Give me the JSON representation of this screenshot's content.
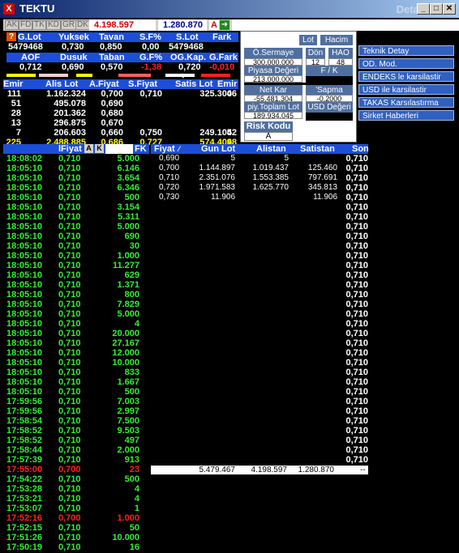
{
  "window": {
    "title": "TEKTU",
    "subtitle": "Detay",
    "icon": "X"
  },
  "toolbar": {
    "tabs": [
      "AK",
      "FD",
      "TK",
      "KD",
      "GR",
      "DK"
    ],
    "value1": "4.198.597",
    "value2": "1.280.870",
    "a_label": "A"
  },
  "summary1": {
    "headers": [
      "G.Lot",
      "Yuksek",
      "Tavan",
      "S.F%",
      "S.Lot",
      "Fark"
    ],
    "values": [
      "5479468",
      "0,730",
      "0,850",
      "0,00",
      "5479468",
      ""
    ]
  },
  "summary2": {
    "headers": [
      "AOF",
      "Dusuk",
      "Taban",
      "G.F%",
      "OG.Kap.",
      "G.Fark"
    ],
    "values": [
      "0,712",
      "0,690",
      "0,570",
      "-1,38",
      "0,720",
      "-0,010"
    ]
  },
  "panel": {
    "lot_btn": "Lot",
    "hacim_btn": "Hacim",
    "sermaye_label": "Ö.Sermaye",
    "sermaye": "300.000.000",
    "don_label": "Dön",
    "don": "12",
    "hao_label": "HAO",
    "hao": "48",
    "piyasa_label": "Piyasa Değeri",
    "piyasa": "213.000.000",
    "fk_label": "F / K",
    "netkar_label": "Net Kar",
    "netkar": "-55.481.304",
    "sapma_label": "'Sapma",
    "sapma": "-0,2000",
    "toplam_label": "piy.Toplam Lot",
    "toplam": "189.934.045",
    "usd_label": "USD Değeri",
    "risk_label": "Risk Kodu",
    "risk": "A"
  },
  "side_buttons": [
    "Teknik Detay",
    "OD. Mod.",
    "ENDEKS le karsilastir",
    "USD ile karsilastir",
    "TAKAS Karsılastırma",
    "Sirket Haberleri"
  ],
  "depth": {
    "headers": [
      "Emir",
      "Alis Lot",
      "A.Fiyat",
      "S.Fiyat",
      "Satis Lot",
      "Emir"
    ],
    "rows": [
      [
        "111",
        "1.162.324",
        "0,700",
        "0,710",
        "325.300",
        "46"
      ],
      [
        "51",
        "495.078",
        "0,690",
        "",
        "",
        ""
      ],
      [
        "28",
        "201.362",
        "0,680",
        "",
        "",
        ""
      ],
      [
        "13",
        "296.875",
        "0,670",
        "",
        "",
        ""
      ],
      [
        "7",
        "206.603",
        "0,660",
        "0,750",
        "249.104",
        "52"
      ]
    ],
    "total": [
      "225",
      "2.488.885",
      "0,686",
      "0,727",
      "574.404",
      "98"
    ]
  },
  "trades": {
    "headers": {
      "fiyat": "lFiyat",
      "a": "A",
      "k": "K",
      "fk": "FK"
    },
    "rows": [
      [
        "18:08:02",
        "0,710",
        "5.000",
        "g"
      ],
      [
        "18:05:10",
        "0,710",
        "6.146",
        "g"
      ],
      [
        "18:05:10",
        "0,710",
        "3.654",
        "g"
      ],
      [
        "18:05:10",
        "0,710",
        "6.346",
        "g"
      ],
      [
        "18:05:10",
        "0,710",
        "500",
        "g"
      ],
      [
        "18:05:10",
        "0,710",
        "3.154",
        "g"
      ],
      [
        "18:05:10",
        "0,710",
        "5.311",
        "g"
      ],
      [
        "18:05:10",
        "0,710",
        "5.000",
        "g"
      ],
      [
        "18:05:10",
        "0,710",
        "690",
        "g"
      ],
      [
        "18:05:10",
        "0,710",
        "30",
        "g"
      ],
      [
        "18:05:10",
        "0,710",
        "1.000",
        "g"
      ],
      [
        "18:05:10",
        "0,710",
        "11.277",
        "g"
      ],
      [
        "18:05:10",
        "0,710",
        "629",
        "g"
      ],
      [
        "18:05:10",
        "0,710",
        "1.371",
        "g"
      ],
      [
        "18:05:10",
        "0,710",
        "800",
        "g"
      ],
      [
        "18:05:10",
        "0,710",
        "7.829",
        "g"
      ],
      [
        "18:05:10",
        "0,710",
        "5.000",
        "g"
      ],
      [
        "18:05:10",
        "0,710",
        "4",
        "g"
      ],
      [
        "18:05:10",
        "0,710",
        "20.000",
        "g"
      ],
      [
        "18:05:10",
        "0,710",
        "27.167",
        "g"
      ],
      [
        "18:05:10",
        "0,710",
        "12.000",
        "g"
      ],
      [
        "18:05:10",
        "0,710",
        "10.000",
        "g"
      ],
      [
        "18:05:10",
        "0,710",
        "833",
        "g"
      ],
      [
        "18:05:10",
        "0,710",
        "1.667",
        "g"
      ],
      [
        "18:05:10",
        "0,710",
        "500",
        "g"
      ],
      [
        "17:59:56",
        "0,710",
        "7.003",
        "g"
      ],
      [
        "17:59:56",
        "0,710",
        "2.997",
        "g"
      ],
      [
        "17:58:54",
        "0,710",
        "7.500",
        "g"
      ],
      [
        "17:58:52",
        "0,710",
        "9.503",
        "g"
      ],
      [
        "17:58:52",
        "0,710",
        "497",
        "g"
      ],
      [
        "17:58:44",
        "0,710",
        "2.000",
        "g"
      ],
      [
        "17:57:39",
        "0,710",
        "913",
        "g"
      ],
      [
        "17:55:00",
        "0,700",
        "23",
        "r"
      ],
      [
        "17:54:22",
        "0,710",
        "500",
        "g"
      ],
      [
        "17:53:28",
        "0,710",
        "4",
        "g"
      ],
      [
        "17:53:21",
        "0,710",
        "4",
        "g"
      ],
      [
        "17:53:07",
        "0,710",
        "1",
        "g"
      ],
      [
        "17:52:16",
        "0,700",
        "1.000",
        "r"
      ],
      [
        "17:52:15",
        "0,710",
        "50",
        "g"
      ],
      [
        "17:51:26",
        "0,710",
        "10.000",
        "g"
      ],
      [
        "17:50:19",
        "0,710",
        "16",
        "g"
      ]
    ]
  },
  "price_depth": {
    "headers": [
      "Fiyat",
      "Gun Lot",
      "Alistan",
      "Satistan",
      "Son"
    ],
    "rows": [
      [
        "0,690",
        "5",
        "5",
        ""
      ],
      [
        "0,700",
        "1.144.897",
        "1.019.437",
        "125.460"
      ],
      [
        "0,710",
        "2.351.076",
        "1.553.385",
        "797.691"
      ],
      [
        "0,720",
        "1.971.583",
        "1.625.770",
        "345.813"
      ],
      [
        "0,730",
        "11.906",
        "",
        "11.906"
      ]
    ],
    "totals": [
      "5.479.467",
      "4.198.597",
      "1.280.870",
      "--"
    ],
    "son_values": [
      "0,710",
      "0,710",
      "0,710",
      "0,710",
      "0,710",
      "0,710",
      "0,710",
      "0,710",
      "0,710",
      "0,710",
      "0,710",
      "0,710",
      "0,710",
      "0,710",
      "0,710",
      "0,710",
      "0,710",
      "0,710",
      "0,710",
      "0,710",
      "0,710",
      "0,710",
      "0,710",
      "0,710",
      "0,710",
      "0,710",
      "0,710",
      "0,710",
      "0,710",
      "0,710",
      "0,710",
      "0,710"
    ]
  },
  "colors": {
    "green": "#33ee33",
    "red": "#ff2020",
    "blue": "#1d4ed8",
    "yellow": "#ffff00"
  }
}
